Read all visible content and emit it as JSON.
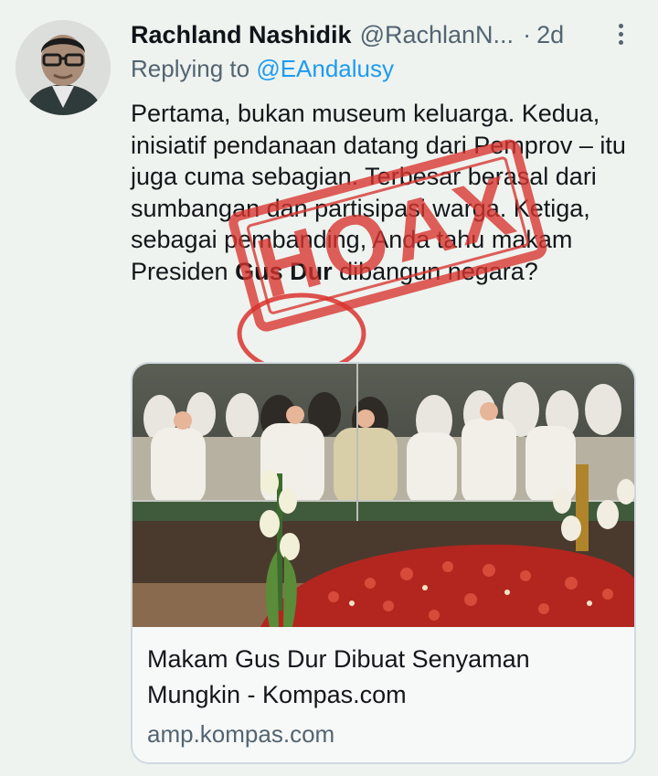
{
  "tweet": {
    "author_name": "Rachland Nashidik",
    "author_handle": "@RachlanN...",
    "separator": "·",
    "time": "2d",
    "replying_prefix": "Replying to",
    "replying_to": "@EAndalusy",
    "text_before_bold": "Pertama, bukan museum keluarga. Kedua, inisiatif pendanaan datang dari Pemprov – itu juga cuma sebagian. Terbesar berasal dari sumbangan dan partisipasi warga. Ketiga, sebagai pembanding, Anda tahu makam Presiden ",
    "text_bold": "Gus Dur",
    "text_after_bold": " dibangun negara?",
    "stamp_text": "HOAX"
  },
  "link_card": {
    "title": "Makam Gus Dur Dibuat Senyaman Mungkin - Kompas.com",
    "domain": "amp.kompas.com"
  },
  "colors": {
    "background": "#eef3ef",
    "muted_text": "#536471",
    "link_blue": "#1d9bf0",
    "stamp_red": "#d9332e"
  }
}
